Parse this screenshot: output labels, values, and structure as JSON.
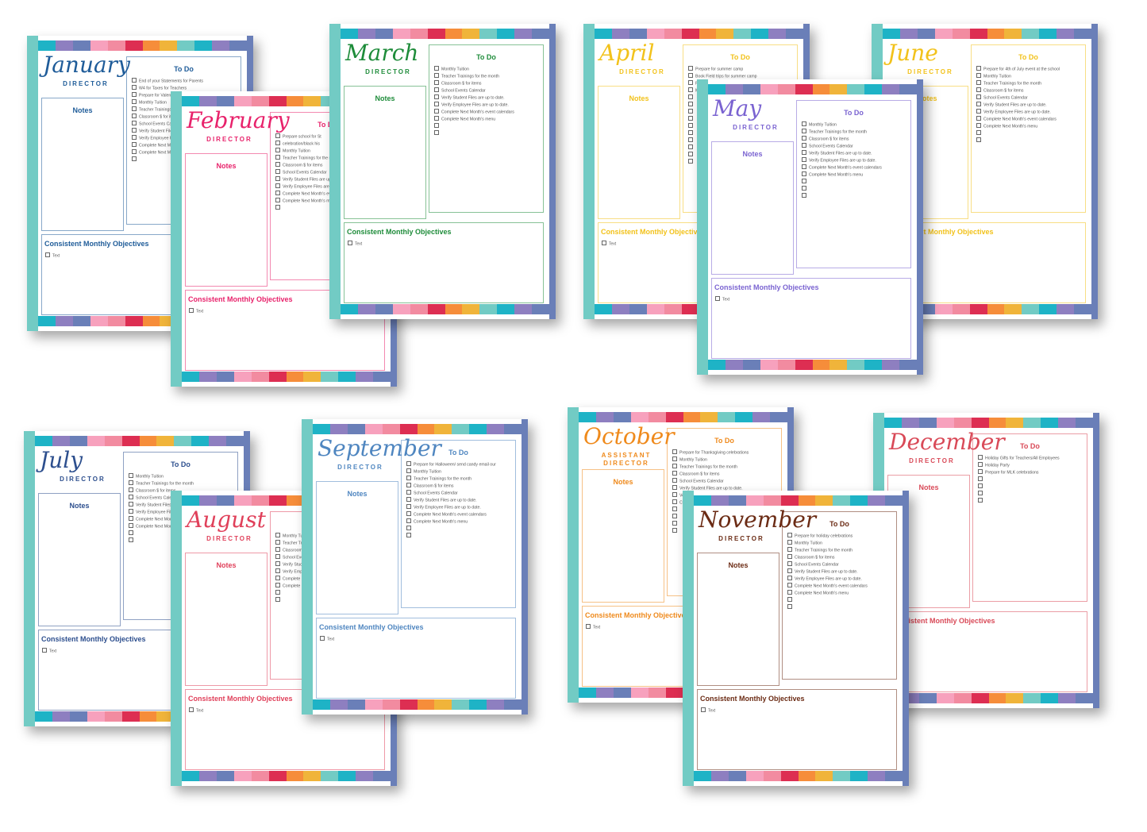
{
  "rainbow_colors": [
    "#1eb3c6",
    "#8e7fc0",
    "#6a7fb8",
    "#f7a1bd",
    "#f28ba0",
    "#dd2e52",
    "#f68d3a",
    "#f0b43a",
    "#72cbc4",
    "#1eb3c6",
    "#8e7fc0",
    "#6a7fb8"
  ],
  "pages": [
    {
      "month": "January",
      "role": "DIRECTOR",
      "accent": "#1f5c99",
      "notes_label": "Notes",
      "todo_label": "To Do",
      "objectives_label": "Consistent Monthly Objectives",
      "objectives_item": "Text",
      "todo_items": [
        "End of your Statements for Parents",
        "W4 for Taxes for Teachers",
        "Prepare for Valentines/Presidents Day Celebrations",
        "Monthly Tuition",
        "Teacher Trainings for the month",
        "Classroom $ for items",
        "School Events Calendar",
        "Verify Student Files are up to date.",
        "Verify Employee Files are up to date.",
        "Complete Next Month's event calendars",
        "Complete Next Month's menu",
        ""
      ]
    },
    {
      "month": "February",
      "role": "DIRECTOR",
      "accent": "#e8226b",
      "notes_label": "Notes",
      "todo_label": "To Do",
      "objectives_label": "Consistent Monthly Objectives",
      "objectives_item": "Text",
      "todo_items": [
        "Prepare school for St",
        "celebration/black his",
        "Monthly Tuition",
        "Teacher Trainings for the month",
        "Classroom $ for items",
        "School Events Calendar",
        "Verify Student Files are up to date.",
        "Verify Employee Files are up to date.",
        "Complete Next Month's event calendars",
        "Complete Next Month's menu",
        ""
      ]
    },
    {
      "month": "March",
      "role": "DIRECTOR",
      "accent": "#1e8c3a",
      "notes_label": "Notes",
      "todo_label": "To Do",
      "objectives_label": "Consistent Monthly Objectives",
      "objectives_item": "Text",
      "todo_items": [
        "Monthly Tuition",
        "Teacher Trainings for the month",
        "Classroom $ for items",
        "School Events Calendar",
        "Verify Student Files are up to date.",
        "Verify Employee Files are up to date.",
        "Complete Next Month's event calendars",
        "Complete Next Month's menu",
        "",
        ""
      ]
    },
    {
      "month": "April",
      "role": "DIRECTOR",
      "accent": "#f2c21b",
      "notes_label": "Notes",
      "todo_label": "To Do",
      "objectives_label": "Consistent Monthly Objectives",
      "objectives_item": "Text",
      "todo_items": [
        "Prepare for summer camp",
        "Book Field trips for summer camp",
        "Prepare for teacher appreciation week",
        "Monthly Tuition",
        "",
        "",
        "",
        "",
        "",
        "",
        "",
        "",
        "",
        ""
      ]
    },
    {
      "month": "May",
      "role": "DIRECTOR",
      "accent": "#7a63d1",
      "notes_label": "Notes",
      "todo_label": "To Do",
      "objectives_label": "Consistent Monthly Objectives",
      "objectives_item": "Text",
      "todo_items": [
        "Monthly Tuition",
        "Teacher Trainings for the month",
        "Classroom $ for items",
        "School Events Calendar",
        "Verify Student Files are up to date.",
        "Verify Employee Files are up to date.",
        "Complete Next Month's event calendars",
        "Complete Next Month's menu",
        "",
        "",
        ""
      ]
    },
    {
      "month": "June",
      "role": "DIRECTOR",
      "accent": "#f2c21b",
      "notes_label": "Notes",
      "todo_label": "To Do",
      "objectives_label": "Consistent Monthly Objectives",
      "objectives_item": "Text",
      "todo_items": [
        "Prepare for 4th of July event at the school",
        "Monthly Tuition",
        "Teacher Trainings for the month",
        "Classroom $ for items",
        "School Events Calendar",
        "Verify Student Files are up to date.",
        "Verify Employee Files are up to date.",
        "Complete Next Month's event calendars",
        "Complete Next Month's menu",
        "",
        ""
      ]
    },
    {
      "month": "July",
      "role": "DIRECTOR",
      "accent": "#2d4f8e",
      "notes_label": "Notes",
      "todo_label": "To Do",
      "objectives_label": "Consistent Monthly Objectives",
      "objectives_item": "Text",
      "todo_items": [
        "Monthly Tuition",
        "Teacher Trainings for the month",
        "Classroom $ for items",
        "School Events Calendar",
        "Verify Student Files are up to date.",
        "Verify Employee Files are up to date.",
        "Complete Next Month's event calendars",
        "Complete Next Month's menu",
        "",
        ""
      ]
    },
    {
      "month": "August",
      "role": "DIRECTOR",
      "accent": "#e0405a",
      "notes_label": "Notes",
      "todo_label": "To Do",
      "objectives_label": "Consistent Monthly Objectives",
      "objectives_item": "Text",
      "todo_items": [
        "Monthly Tuition",
        "Teacher Trainings for the month",
        "Classroom $ for items",
        "School Events Calendar",
        "Verify Student Files are up to date.",
        "Verify Employee Files are up to date.",
        "Complete Next Month's event calendars",
        "Complete Next Month's menu",
        "",
        ""
      ]
    },
    {
      "month": "September",
      "role": "DIRECTOR",
      "accent": "#4f86c0",
      "notes_label": "Notes",
      "todo_label": "To Do",
      "objectives_label": "Consistent Monthly Objectives",
      "objectives_item": "Text",
      "todo_items": [
        "Prepare for Halloween/ send candy email our",
        "Monthly Tuition",
        "Teacher Trainings for the month",
        "Classroom $ for items",
        "School Events Calendar",
        "Verify Student Files are up to date.",
        "Verify Employee Files are up to date.",
        "Complete Next Month's event calendars",
        "Complete Next Month's menu",
        "",
        ""
      ]
    },
    {
      "month": "October",
      "role": "ASSISTANT DIRECTOR",
      "accent": "#ef8a1c",
      "notes_label": "Notes",
      "todo_label": "To Do",
      "objectives_label": "Consistent Monthly Objectives",
      "objectives_item": "Text",
      "todo_items": [
        "Prepare for Thanksgiving celebrations",
        "Monthly Tuition",
        "Teacher Trainings for the month",
        "Classroom $ for items",
        "School Events Calendar",
        "Verify Student Files are up to date.",
        "Verify Employee Files are up to date.",
        "Complete Next Month's event calendars",
        "",
        "",
        "",
        ""
      ]
    },
    {
      "month": "November",
      "role": "DIRECTOR",
      "accent": "#6b2b14",
      "notes_label": "Notes",
      "todo_label": "To Do",
      "objectives_label": "Consistent Monthly Objectives",
      "objectives_item": "Text",
      "todo_items": [
        "Prepare for holiday celebrations",
        "Monthly Tuition",
        "Teacher Trainings for the month",
        "Classroom $ for items",
        "School Events Calendar",
        "Verify Student Files are up to date.",
        "Verify Employee Files are up to date.",
        "Complete Next Month's event calendars",
        "Complete Next Month's menu",
        "",
        ""
      ]
    },
    {
      "month": "December",
      "role": "DIRECTOR",
      "accent": "#d94a58",
      "notes_label": "Notes",
      "todo_label": "To Do",
      "objectives_label": "Consistent Monthly Objectives",
      "objectives_item": "Text",
      "todo_items": [
        "Holiday Gifts for Teachers/All Employees",
        "Holiday Party",
        "Prepare for MLK celebrations",
        "",
        "",
        "",
        ""
      ]
    }
  ]
}
